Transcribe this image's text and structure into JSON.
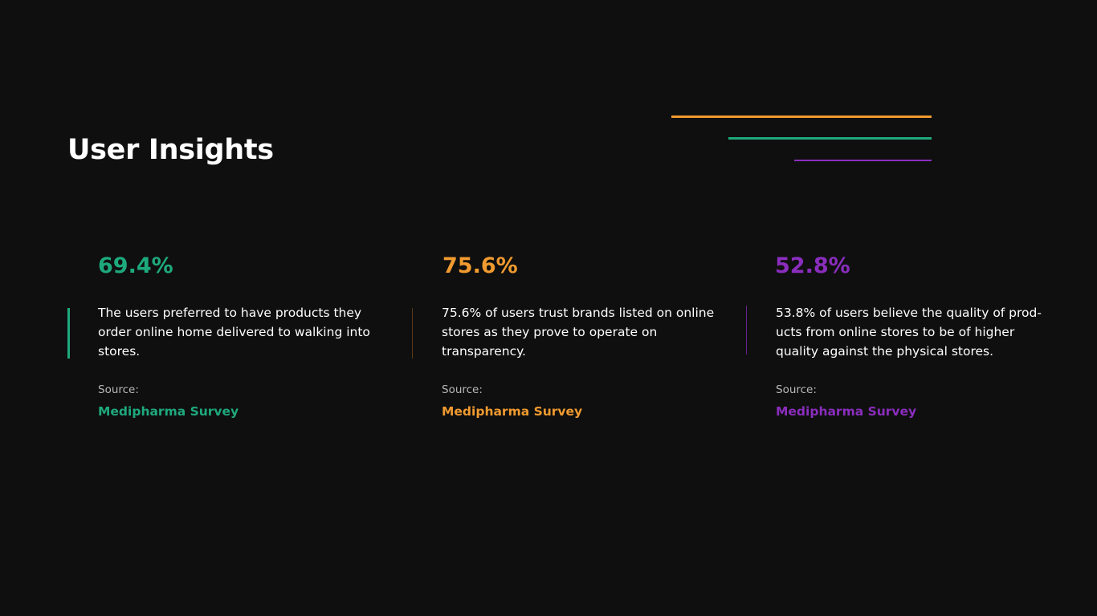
{
  "page": {
    "title": "User Insights"
  },
  "colors": {
    "background": "#0f0f0f",
    "green": "#1ea97c",
    "orange": "#f09a2f",
    "purple": "#8a2dbd"
  },
  "insights": [
    {
      "value": "69.4%",
      "description": "The users preferred to have products they order online home delivered to walking into stores.",
      "source_label": "Source:",
      "source_name": "Medipharma Survey",
      "color": "#1ea97c"
    },
    {
      "value": "75.6%",
      "description": "75.6% of users trust brands listed on online stores as they prove to operate on transparency.",
      "source_label": "Source:",
      "source_name": "Medipharma Survey",
      "color": "#f09a2f"
    },
    {
      "value": "52.8%",
      "description": "53.8% of users believe the quality of prod-ucts from online stores to be of higher quality against the physical stores.",
      "source_label": "Source:",
      "source_name": "Medipharma Survey",
      "color": "#8a2dbd"
    }
  ]
}
